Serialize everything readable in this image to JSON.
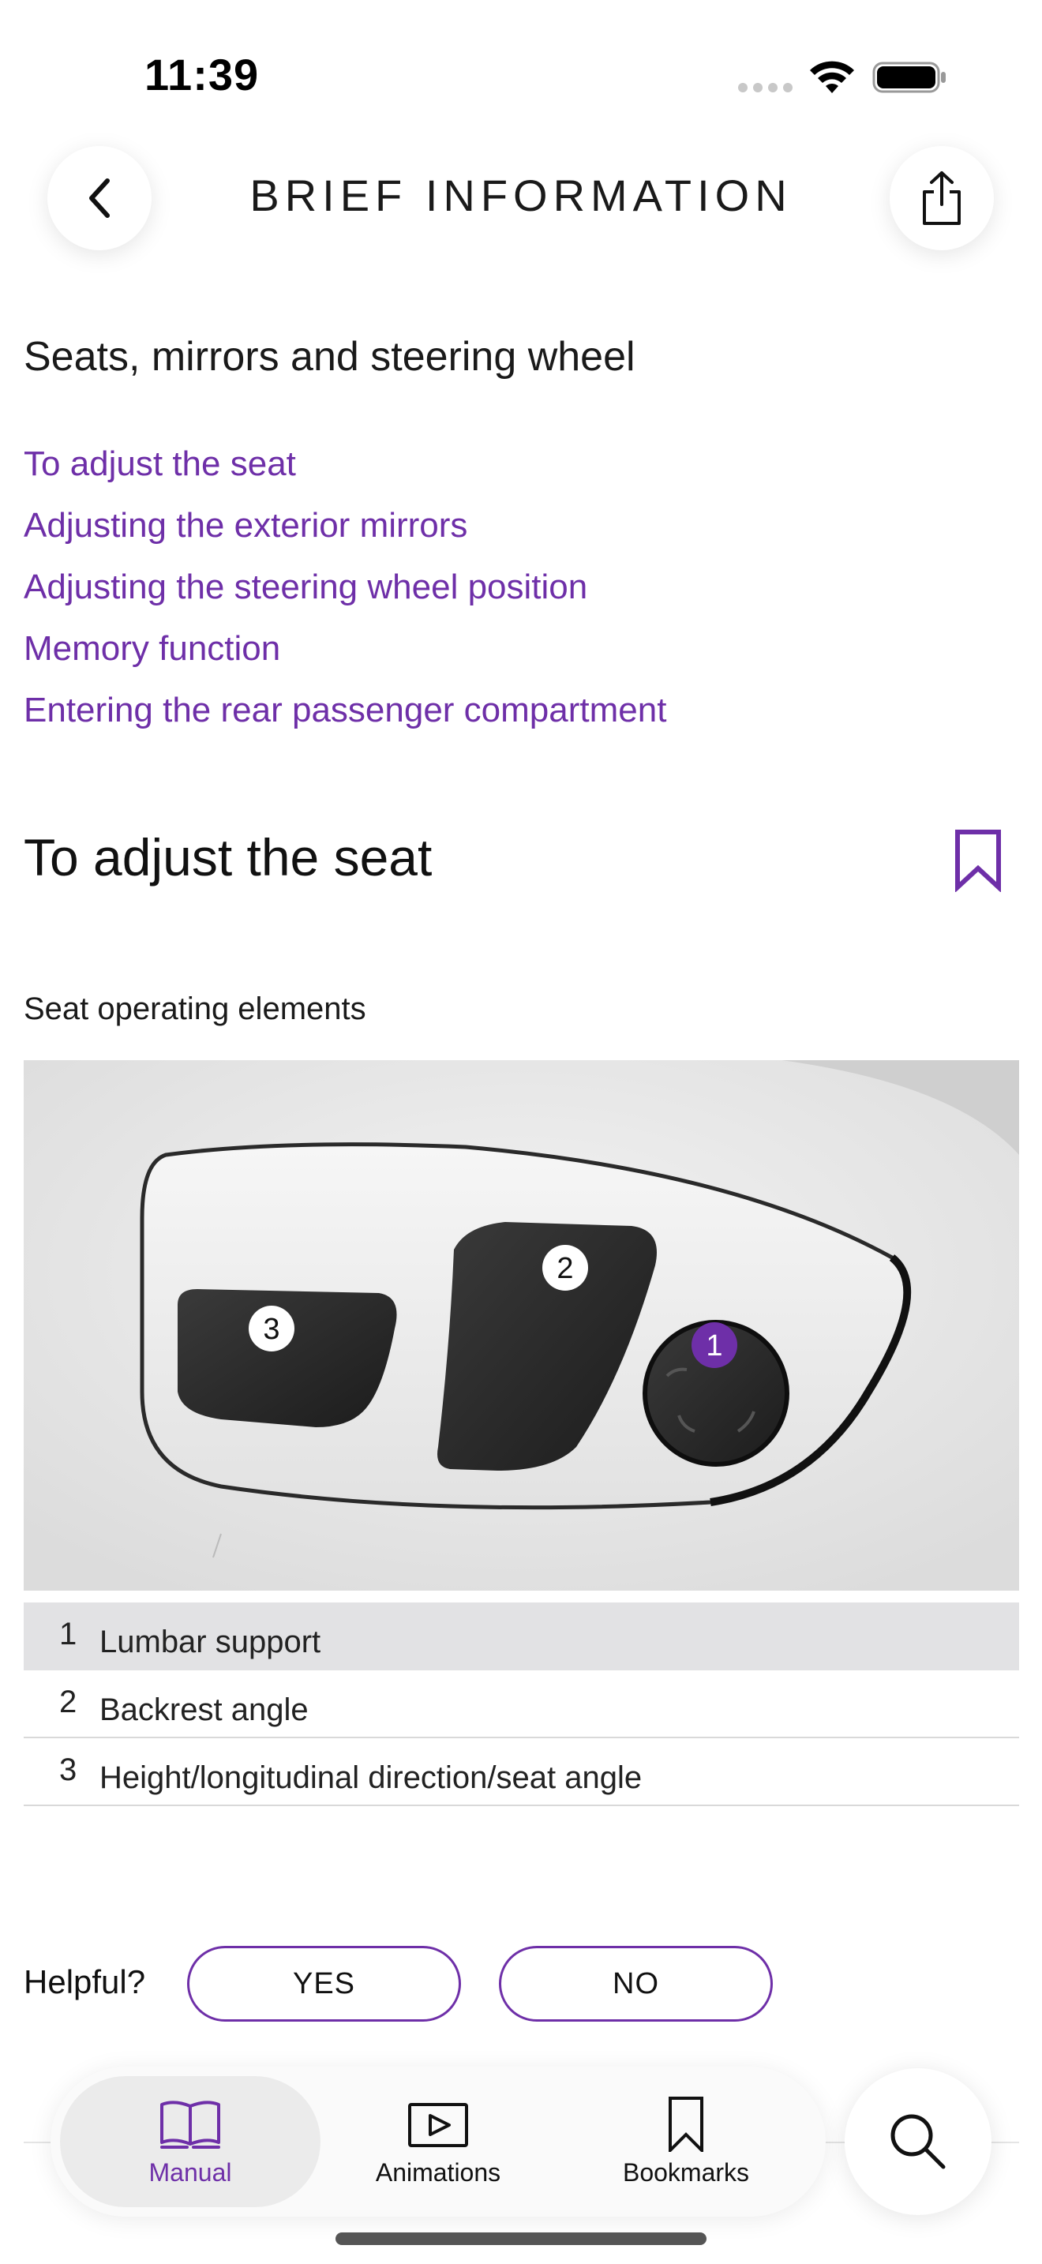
{
  "status_bar": {
    "time": "11:39"
  },
  "header": {
    "title": "BRIEF INFORMATION",
    "back_icon": "chevron-left-icon",
    "share_icon": "share-icon"
  },
  "section": {
    "title": "Seats, mirrors and steering wheel",
    "links": [
      "To adjust the seat",
      "Adjusting the exterior mirrors",
      "Adjusting the steering wheel position",
      "Memory function",
      "Entering the rear passenger compartment"
    ]
  },
  "topic": {
    "title": "To adjust the seat",
    "bookmark_icon": "bookmark-icon"
  },
  "figure": {
    "caption": "Seat operating elements",
    "callouts": [
      "1",
      "2",
      "3"
    ],
    "highlighted_callout": "1"
  },
  "legend": [
    {
      "num": "1",
      "label": "Lumbar support",
      "highlighted": true
    },
    {
      "num": "2",
      "label": "Backrest angle",
      "highlighted": false
    },
    {
      "num": "3",
      "label": "Height/longitudinal direction/seat angle",
      "highlighted": false
    }
  ],
  "feedback": {
    "label": "Helpful?",
    "yes": "YES",
    "no": "NO"
  },
  "tabbar": {
    "tabs": [
      {
        "label": "Manual",
        "icon": "book-icon",
        "active": true
      },
      {
        "label": "Animations",
        "icon": "play-icon",
        "active": false
      },
      {
        "label": "Bookmarks",
        "icon": "bookmark-icon",
        "active": false
      }
    ],
    "search_icon": "search-icon"
  },
  "colors": {
    "accent": "#6e2fa8",
    "highlight_row": "#e2e2e4"
  }
}
